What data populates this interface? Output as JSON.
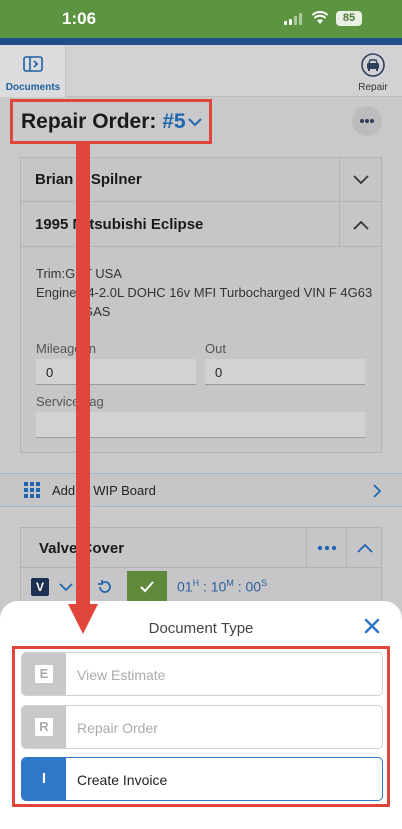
{
  "status_bar": {
    "time": "1:06",
    "battery": "85"
  },
  "toolbar": {
    "documents_label": "Documents",
    "repair_label": "Repair"
  },
  "header": {
    "title_prefix": "Repair Order:",
    "order_number": "#5"
  },
  "customer": {
    "name": "Brian F Spilner"
  },
  "vehicle": {
    "name": "1995 Mitsubishi Eclipse",
    "trim_label": "Trim:",
    "trim_value": "GST USA",
    "engine_label": "Engine:",
    "engine_value_line1": "L4-2.0L DOHC 16v MFI Turbocharged VIN F 4G63",
    "engine_value_line2": "GAS"
  },
  "fields": {
    "mileage_in_label": "Mileage In",
    "mileage_in_value": "0",
    "out_label": "Out",
    "out_value": "0",
    "service_tag_label": "Service Tag",
    "service_tag_value": ""
  },
  "wip": {
    "label": "Add to WIP Board"
  },
  "job": {
    "title": "Valve Cover",
    "badge": "V",
    "timer_h": "01",
    "timer_m": "10",
    "timer_s": "00"
  },
  "sheet": {
    "title": "Document Type",
    "options": [
      {
        "letter": "E",
        "label": "View Estimate",
        "selected": false
      },
      {
        "letter": "R",
        "label": "Repair Order",
        "selected": false
      },
      {
        "letter": "I",
        "label": "Create Invoice",
        "selected": true
      }
    ]
  },
  "colors": {
    "status_green": "#5d9441",
    "brand_blue": "#1f4f86",
    "accent_blue": "#2f77c8",
    "annotation_red": "#e0463c"
  },
  "icons": {
    "documents": "sidebar-panel-icon",
    "repair": "car-in-circle-icon",
    "more": "more-horizontal-icon",
    "close": "close-x-icon",
    "wip": "grid-icon"
  }
}
